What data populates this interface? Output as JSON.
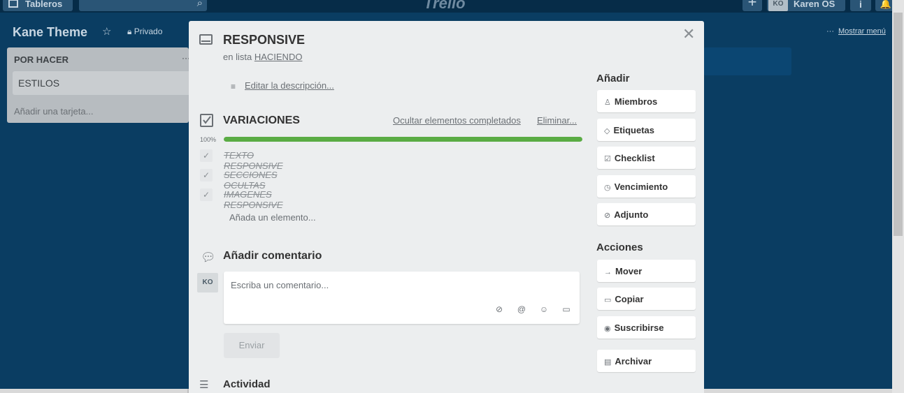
{
  "topbar": {
    "boards_label": "Tableros",
    "logo_text": "Trello",
    "avatar_initials": "KO",
    "username": "Karen OS"
  },
  "board": {
    "title": "Kane Theme",
    "privacy": "Privado",
    "show_menu": "Mostrar menú"
  },
  "list": {
    "title": "POR HACER",
    "cards": [
      "ESTILOS"
    ],
    "add_card": "Añadir una tarjeta..."
  },
  "modal": {
    "card_title": "RESPONSIVE",
    "in_list_prefix": "en lista",
    "in_list_name": "HACIENDO",
    "edit_description": "Editar la descripción...",
    "checklist": {
      "title": "VARIACIONES",
      "hide_completed": "Ocultar elementos completados",
      "delete": "Eliminar...",
      "progress_label": "100%",
      "progress_fraction": 1.0,
      "items": [
        {
          "text": "TEXTO RESPONSIVE",
          "done": true
        },
        {
          "text": "SECCIONES OCULTAS",
          "done": true
        },
        {
          "text": "IMAGENES RESPONSIVE",
          "done": true
        }
      ],
      "add_item": "Añada un elemento..."
    },
    "comment": {
      "title": "Añadir comentario",
      "avatar": "KO",
      "placeholder": "Escriba un comentario...",
      "send": "Enviar"
    },
    "activity_title": "Actividad",
    "sidebar": {
      "add_heading": "Añadir",
      "add_buttons": [
        "Miembros",
        "Etiquetas",
        "Checklist",
        "Vencimiento",
        "Adjunto"
      ],
      "actions_heading": "Acciones",
      "action_buttons": [
        "Mover",
        "Copiar",
        "Suscribirse",
        "Archivar"
      ]
    }
  },
  "colors": {
    "board_bg": "#0a3d62",
    "progress_green": "#5aac44"
  }
}
